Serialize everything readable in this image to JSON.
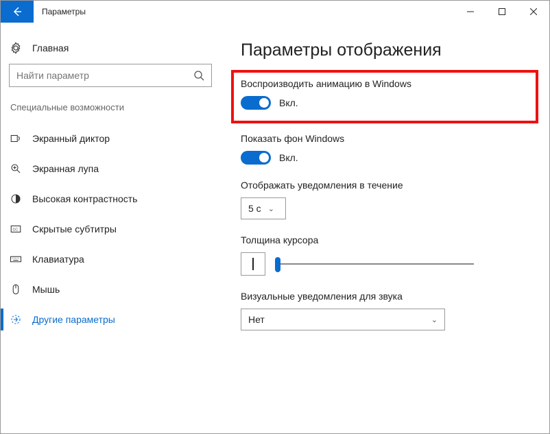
{
  "window": {
    "title": "Параметры"
  },
  "sidebar": {
    "home": "Главная",
    "search_placeholder": "Найти параметр",
    "section": "Специальные возможности",
    "items": [
      {
        "label": "Экранный диктор"
      },
      {
        "label": "Экранная лупа"
      },
      {
        "label": "Высокая контрастность"
      },
      {
        "label": "Скрытые субтитры"
      },
      {
        "label": "Клавиатура"
      },
      {
        "label": "Мышь"
      },
      {
        "label": "Другие параметры"
      }
    ]
  },
  "main": {
    "title": "Параметры отображения",
    "play_animations": {
      "label": "Воспроизводить анимацию в Windows",
      "state": "Вкл."
    },
    "show_background": {
      "label": "Показать фон Windows",
      "state": "Вкл."
    },
    "notify_duration": {
      "label": "Отображать уведомления в течение",
      "value": "5 с"
    },
    "cursor_thickness": {
      "label": "Толщина курсора"
    },
    "visual_sound": {
      "label": "Визуальные уведомления для звука",
      "value": "Нет"
    }
  }
}
